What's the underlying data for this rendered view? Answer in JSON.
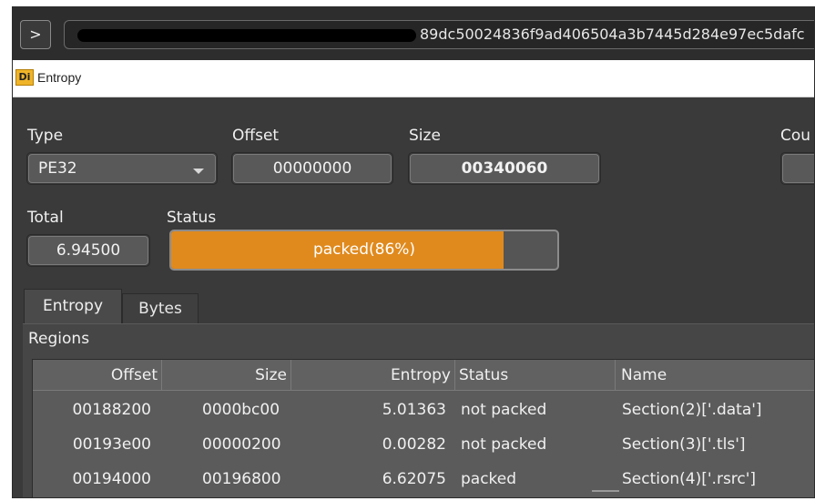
{
  "path_bar": {
    "go_label": ">",
    "path_visible": "89dc50024836f9ad406504a3b7445d284e97ec5dafc"
  },
  "window": {
    "icon_text": "Di",
    "title": "Entropy"
  },
  "fields": {
    "type_label": "Type",
    "type_value": "PE32",
    "offset_label": "Offset",
    "offset_value": "00000000",
    "size_label": "Size",
    "size_value": "00340060",
    "count_label": "Cou",
    "total_label": "Total",
    "total_value": "6.94500",
    "status_label": "Status",
    "status_text": "packed(86%)",
    "status_fill": 0.86
  },
  "tabs": [
    {
      "label": "Entropy",
      "active": true
    },
    {
      "label": "Bytes",
      "active": false
    }
  ],
  "regions": {
    "label": "Regions",
    "columns": [
      "Offset",
      "Size",
      "Entropy",
      "Status",
      "Name"
    ],
    "rows": [
      [
        "00188200",
        "0000bc00",
        "5.01363",
        "not packed",
        "Section(2)['.data']"
      ],
      [
        "00193e00",
        "00000200",
        "0.00282",
        "not packed",
        "Section(3)['.tls']"
      ],
      [
        "00194000",
        "00196800",
        "6.62075",
        "packed",
        "Section(4)['.rsrc']"
      ]
    ]
  },
  "colors": {
    "progress_fill": "#e08a1e",
    "background": "#3a3a3a"
  }
}
